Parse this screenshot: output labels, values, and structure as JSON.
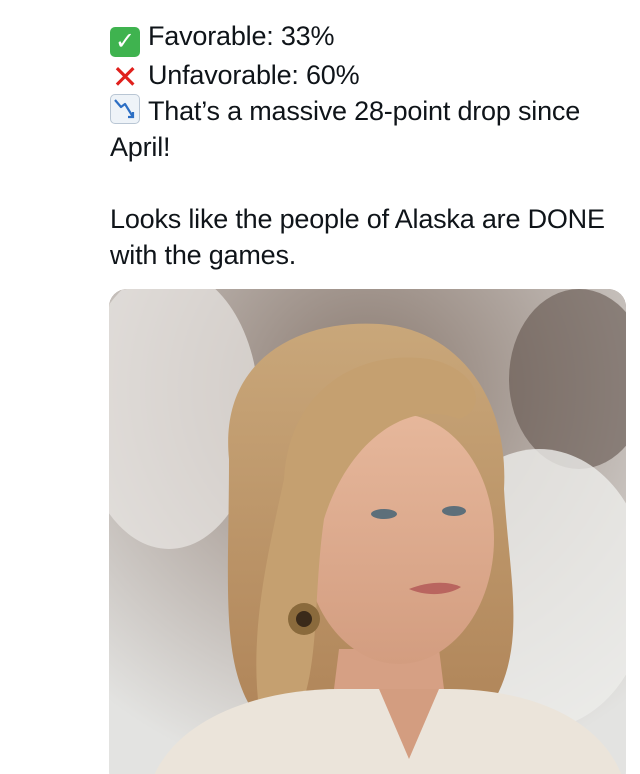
{
  "tweet": {
    "lines": [
      {
        "icon": "check-mark-icon",
        "text": "Favorable: 33%"
      },
      {
        "icon": "cross-mark-icon",
        "text": "Unfavorable: 60%"
      },
      {
        "icon": "chart-decreasing-icon",
        "text": "That’s a massive 28-point drop since April!"
      }
    ],
    "paragraph": "Looks like the people of Alaska are DONE with the games."
  },
  "media": {
    "subject": "photo-of-woman",
    "alt": ""
  },
  "colors": {
    "text": "#0f1419",
    "check_green": "#3fb34f",
    "cross_red": "#e0201c"
  }
}
